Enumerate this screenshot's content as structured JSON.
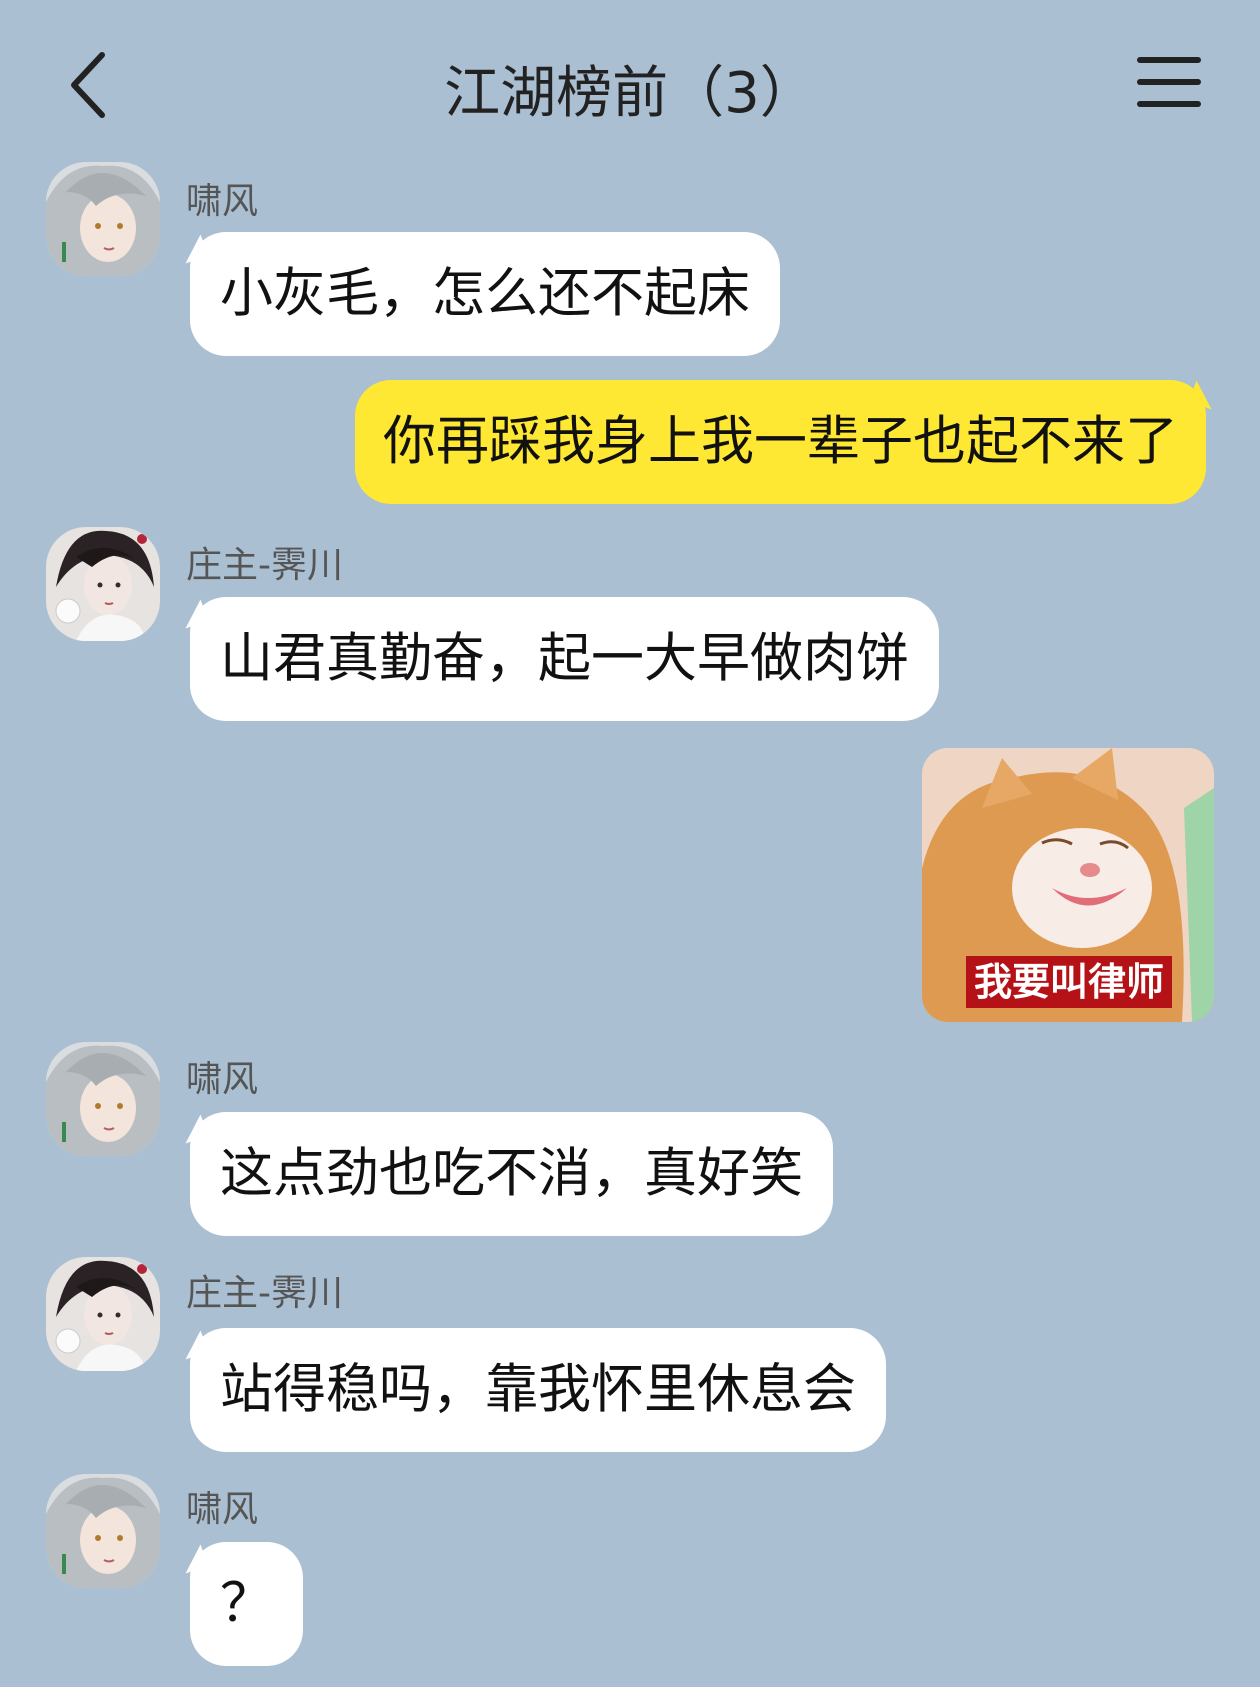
{
  "header": {
    "title": "江湖榜前（3）",
    "back_icon": "chevron-left-icon",
    "menu_icon": "hamburger-menu-icon"
  },
  "colors": {
    "background": "#aabfd2",
    "my_bubble": "#ffe833",
    "other_bubble": "#ffffff",
    "sticker_caption_bg": "#b51217"
  },
  "messages": [
    {
      "sender": "啸风",
      "text": "小灰毛，怎么还不起床"
    },
    {
      "sender": "",
      "text": "你再踩我身上我一辈子也起不来了"
    },
    {
      "sender": "庄主-霁川",
      "text": "山君真勤奋，起一大早做肉饼"
    },
    {
      "sender": "",
      "sticker_caption": "我要叫律师"
    },
    {
      "sender": "啸风",
      "text": "这点劲也吃不消，真好笑"
    },
    {
      "sender": "庄主-霁川",
      "text": "站得稳吗，靠我怀里休息会"
    },
    {
      "sender": "啸风",
      "text": "？"
    }
  ]
}
